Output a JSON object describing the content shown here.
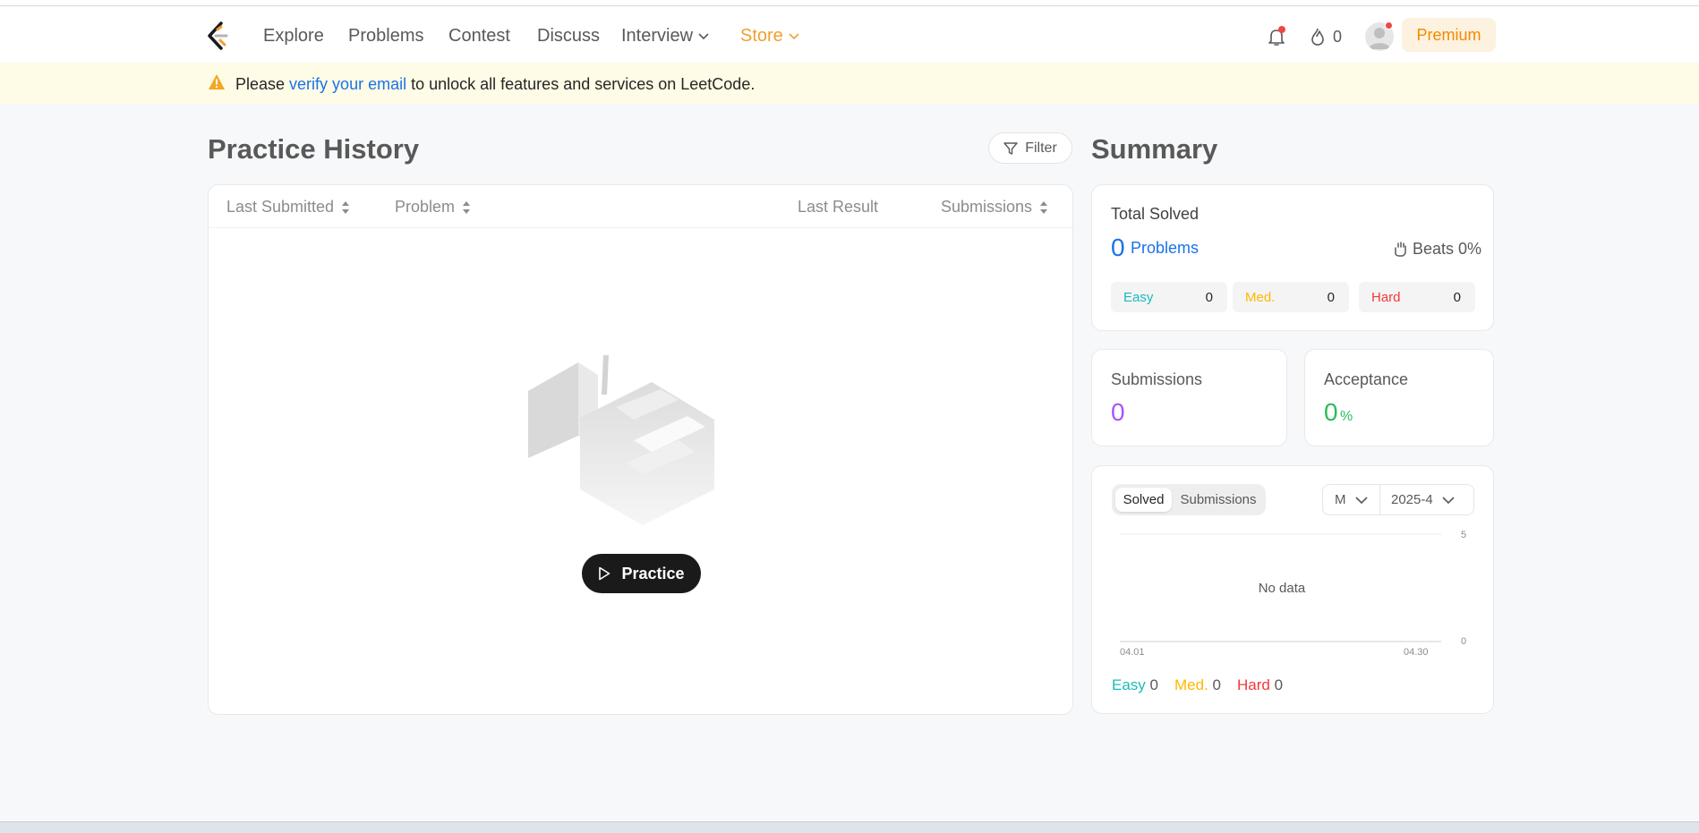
{
  "nav": {
    "items": [
      "Explore",
      "Problems",
      "Contest",
      "Discuss",
      "Interview",
      "Store"
    ],
    "streak_count": "0",
    "premium_label": "Premium"
  },
  "banner": {
    "prefix": "Please ",
    "link": "verify your email",
    "suffix": " to unlock all features and services on LeetCode."
  },
  "practice": {
    "title": "Practice History",
    "filter_label": "Filter",
    "columns": [
      "Last Submitted",
      "Problem",
      "Last Result",
      "Submissions"
    ],
    "button_label": "Practice"
  },
  "summary": {
    "title": "Summary",
    "total_solved_label": "Total Solved",
    "total_solved": "0",
    "problems_label": "Problems",
    "beats": "Beats 0%",
    "difficulties": [
      {
        "name": "Easy",
        "value": "0",
        "color": "#1cbaba"
      },
      {
        "name": "Med.",
        "value": "0",
        "color": "#ffb700"
      },
      {
        "name": "Hard",
        "value": "0",
        "color": "#f63737"
      }
    ],
    "submissions_label": "Submissions",
    "submissions_value": "0",
    "acceptance_label": "Acceptance",
    "acceptance_value": "0",
    "acceptance_unit": "%"
  },
  "chart": {
    "tabs": [
      "Solved",
      "Submissions"
    ],
    "active_tab": "Solved",
    "period": "M",
    "month": "2025-4",
    "no_data": "No data",
    "y_ticks": [
      "5",
      "0"
    ],
    "x_ticks": [
      "04.01",
      "04.30"
    ],
    "legend": [
      {
        "name": "Easy",
        "value": "0"
      },
      {
        "name": "Med.",
        "value": "0"
      },
      {
        "name": "Hard",
        "value": "0"
      }
    ]
  },
  "colors": {
    "accent_blue": "#1a73e8",
    "purple": "#a855f7",
    "green": "#2cbb5d",
    "store_orange": "#f0a030"
  }
}
